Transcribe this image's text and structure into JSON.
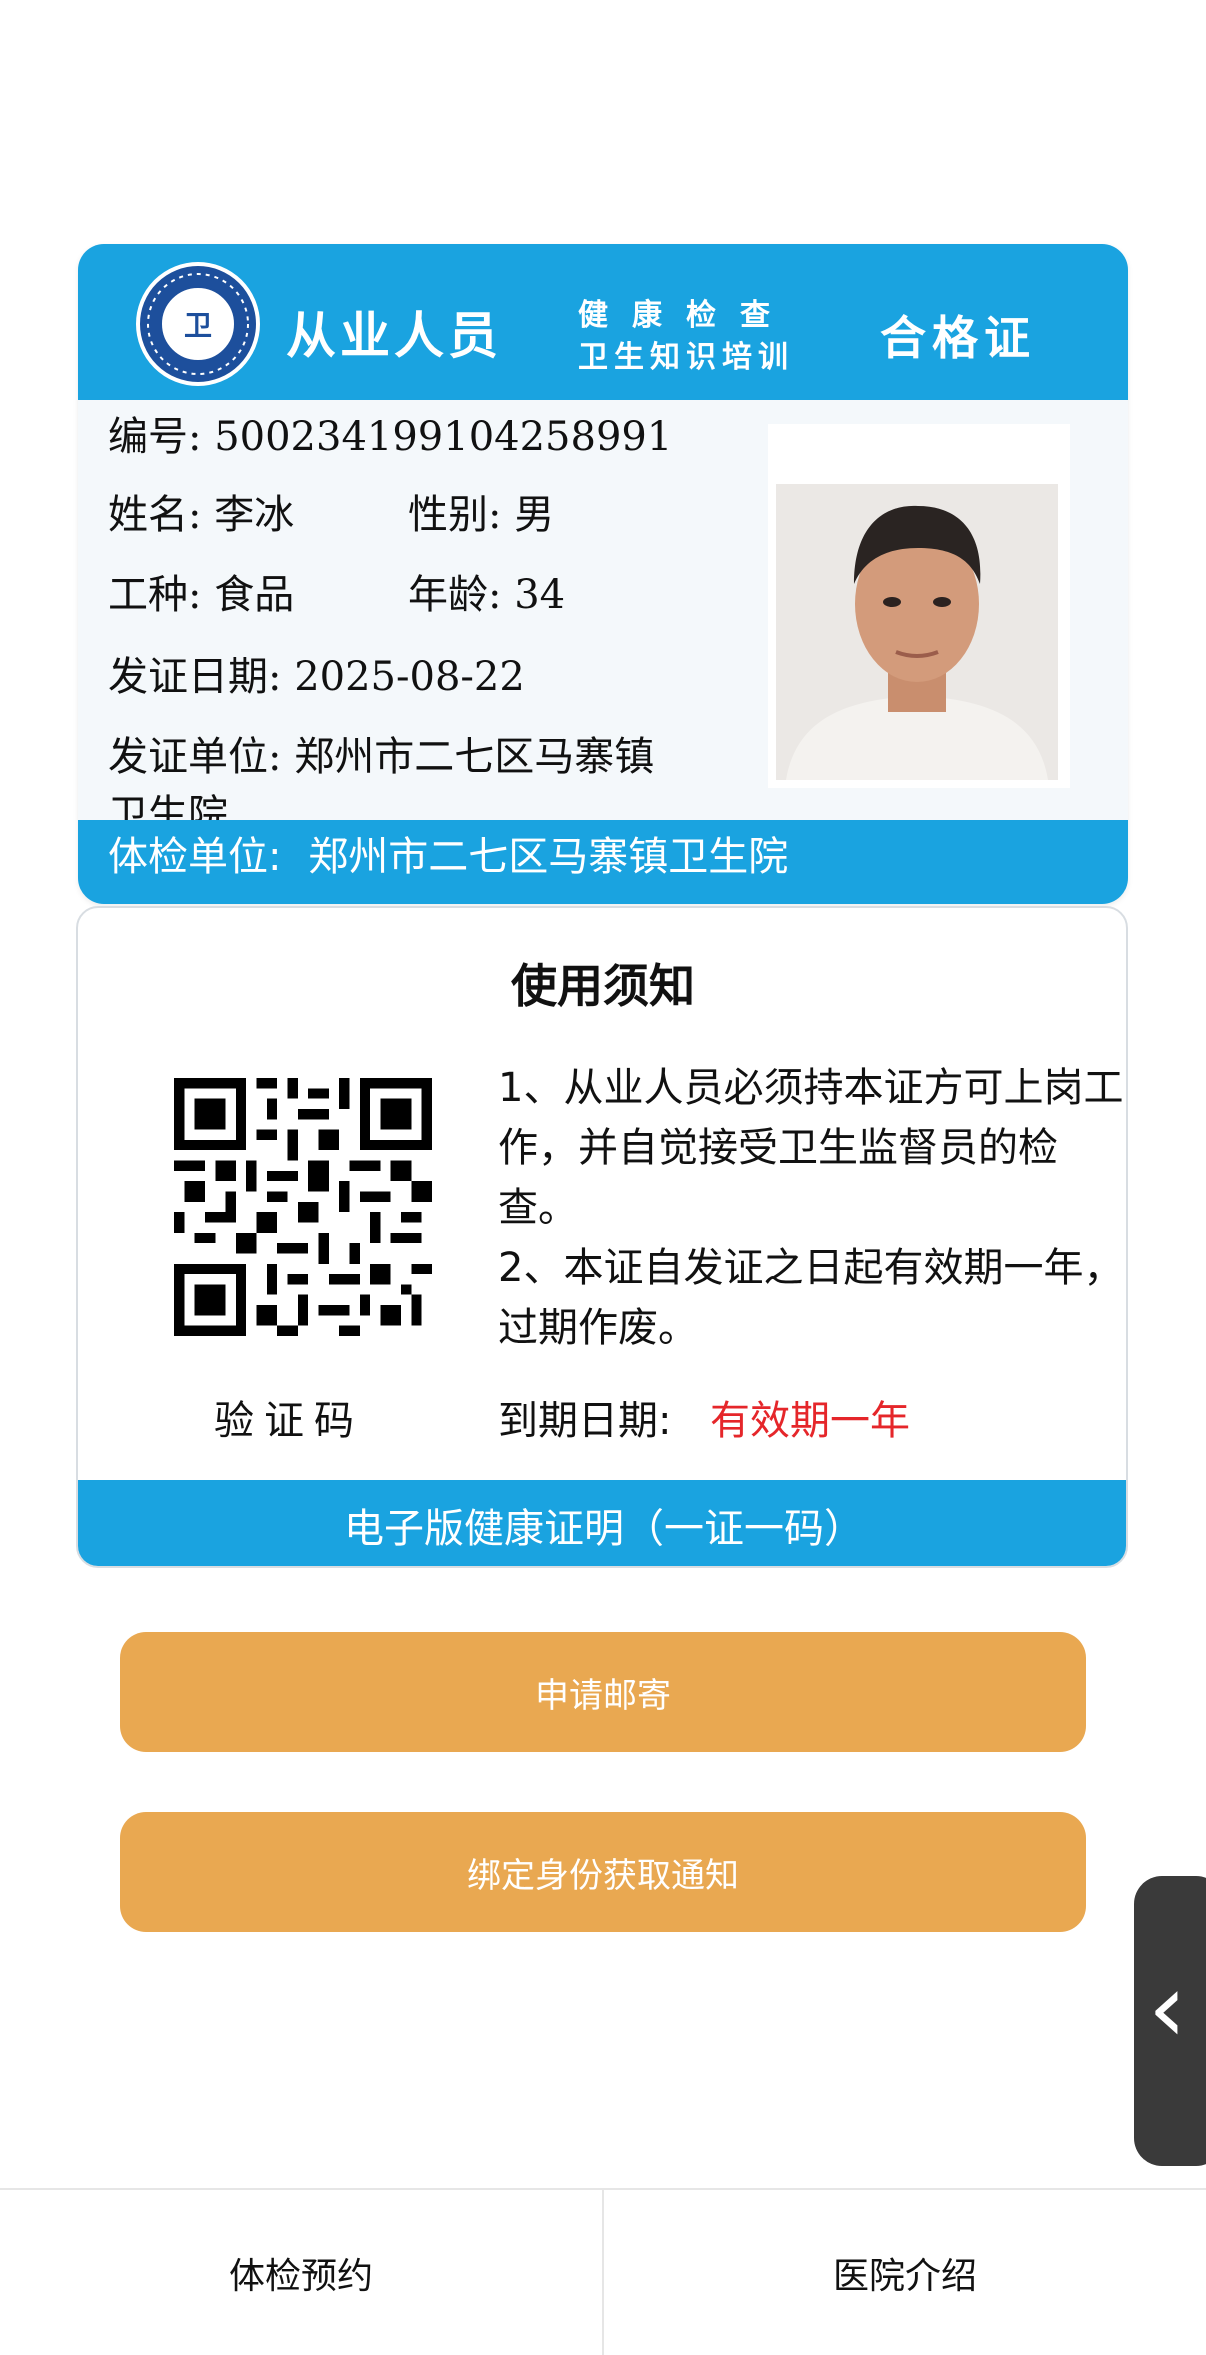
{
  "certificate": {
    "header": {
      "title_left": "从业人员",
      "title_mid_line1": "健康检查",
      "title_mid_line2": "卫生知识培训",
      "title_right": "合格证",
      "emblem_text": "卫"
    },
    "number_label": "编号:",
    "number_value": "500234199104258991",
    "name_label": "姓名:",
    "name_value": "李冰",
    "gender_label": "性别:",
    "gender_value": "男",
    "job_label": "工种:",
    "job_value": "食品",
    "age_label": "年龄:",
    "age_value": "34",
    "issue_date_label": "发证日期:",
    "issue_date_value": "2025-08-22",
    "issuer_label": "发证单位:",
    "issuer_value_line1": "郑州市二七区马寨镇",
    "issuer_value_line2": "卫生院",
    "exam_unit_label": "体检单位:",
    "exam_unit_value": "郑州市二七区马寨镇卫生院"
  },
  "notice": {
    "title": "使用须知",
    "rule1": "1、从业人员必须持本证方可上岗工作，并自觉接受卫生监督员的检查。",
    "rule2": "2、本证自发证之日起有效期一年，过期作废。",
    "verify_label": "验证码",
    "expire_label": "到期日期:",
    "expire_value": "有效期一年",
    "footer": "电子版健康证明（一证一码）"
  },
  "buttons": {
    "mail": "申请邮寄",
    "bind": "绑定身份获取通知"
  },
  "nav": {
    "left": "体检预约",
    "right": "医院介绍"
  },
  "colors": {
    "header_blue": "#1aa3e0",
    "button_orange": "#e9a851",
    "expire_red": "#e5262a"
  },
  "icons": {
    "side_handle": "chevron-left-icon",
    "emblem": "health-inspection-emblem-icon"
  }
}
